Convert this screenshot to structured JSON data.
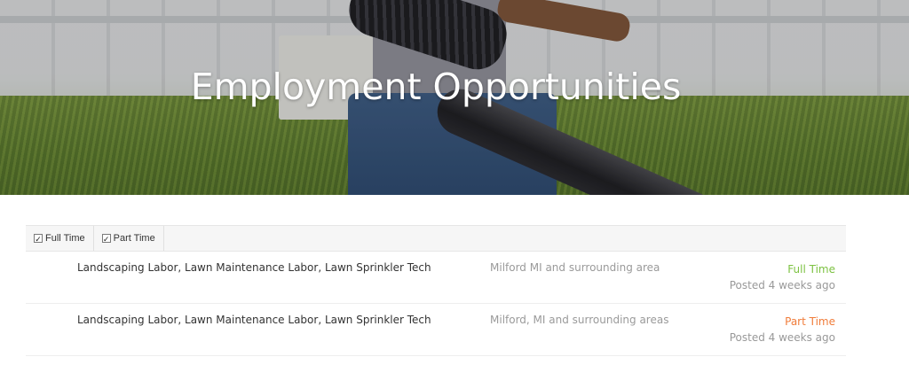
{
  "hero": {
    "title": "Employment Opportunities"
  },
  "filters": [
    {
      "label": "Full Time",
      "checked": true
    },
    {
      "label": "Part Time",
      "checked": true
    }
  ],
  "jobs": [
    {
      "title": "Landscaping Labor, Lawn Maintenance Labor, Lawn Sprinkler Tech",
      "location": "Milford MI and surrounding area",
      "type": "Full Time",
      "type_color": "#7dc242",
      "posted": "Posted 4 weeks ago"
    },
    {
      "title": "Landscaping Labor, Lawn Maintenance Labor, Lawn Sprinkler Tech",
      "location": "Milford, MI and surrounding areas",
      "type": "Part Time",
      "type_color": "#f07c3a",
      "posted": "Posted 4 weeks ago"
    }
  ],
  "icons": {
    "checkbox": "checkbox-checked-icon"
  }
}
